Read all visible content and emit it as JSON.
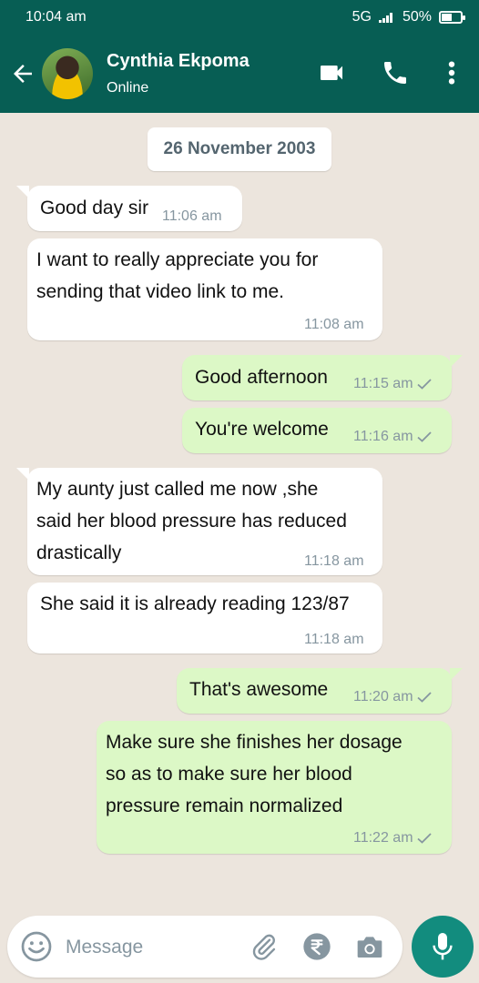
{
  "status_bar": {
    "time": "10:04 am",
    "network": "5G",
    "battery": "50%",
    "battery_level": 0.5
  },
  "header": {
    "contact_name": "Cynthia Ekpoma",
    "contact_status": "Online",
    "icons": [
      "back-arrow-icon",
      "avatar",
      "video-call-icon",
      "voice-call-icon",
      "more-vert-icon"
    ],
    "color": "#075E54"
  },
  "date_divider": "26 November 2003",
  "messages": [
    {
      "direction": "in",
      "text": "Good day sir",
      "time": "11:06 am"
    },
    {
      "direction": "in",
      "text": "I want to really appreciate you for\nsending that video link to me.",
      "time": "11:08 am"
    },
    {
      "direction": "out",
      "text": "Good afternoon",
      "time": "11:15 am",
      "status": "sent"
    },
    {
      "direction": "out",
      "text": "You're welcome",
      "time": "11:16 am",
      "status": "sent"
    },
    {
      "direction": "in",
      "text": "My aunty just called me now ,she\nsaid her blood pressure has reduced\ndrastically",
      "time": "11:18 am"
    },
    {
      "direction": "in",
      "text": "She said it is already reading 123/87",
      "time": "11:18 am"
    },
    {
      "direction": "out",
      "text": "That's awesome",
      "time": "11:20 am",
      "status": "sent"
    },
    {
      "direction": "out",
      "text": "Make sure she finishes her dosage\nso as to make sure her blood\npressure remain normalized",
      "time": "11:22 am",
      "status": "sent"
    }
  ],
  "composer": {
    "placeholder": "Message",
    "value": "",
    "icons": [
      "emoji-icon",
      "attach-icon",
      "payment-icon",
      "camera-icon",
      "mic-icon"
    ]
  },
  "colors": {
    "incoming": "#FFFFFF",
    "outgoing": "#DCF8C6",
    "background": "#ECE5DD",
    "accent": "#128C7E"
  }
}
